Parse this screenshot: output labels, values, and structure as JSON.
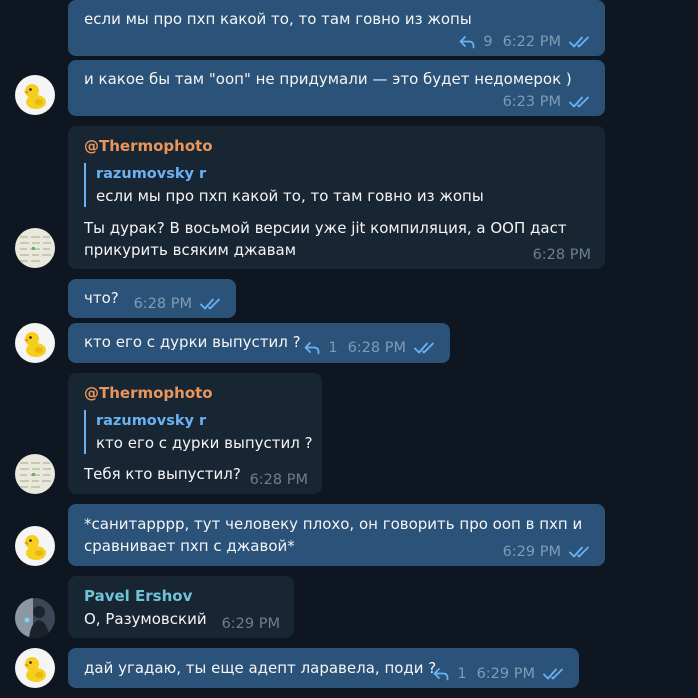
{
  "messages": [
    {
      "text": "если мы про пхп какой то, то там говно из жопы",
      "reply_count": "9",
      "time": "6:22 PM"
    },
    {
      "text": "и какое бы там \"ооп\" не придумали — это будет недомерок )",
      "time": "6:23 PM"
    },
    {
      "sender": "@Thermophoto",
      "quote_name": "razumovsky r",
      "quote_text": "если мы про пхп какой то, то там говно из жопы",
      "text_line1": "Ты дурак? В восьмой версии уже jit компиляция, а ООП даст",
      "text_line2": "прикурить всяким джавам",
      "time": "6:28 PM"
    },
    {
      "text": "что?",
      "time": "6:28 PM"
    },
    {
      "text": "кто его с дурки выпустил ?",
      "reply_count": "1",
      "time": "6:28 PM"
    },
    {
      "sender": "@Thermophoto",
      "quote_name": "razumovsky r",
      "quote_text": "кто его с дурки выпустил ?",
      "text": "Тебя кто выпустил?",
      "time": "6:28 PM"
    },
    {
      "text_line1": "*санитарррр, тут человеку плохо, он говорить про ооп в пхп и",
      "text_line2": "сравнивает пхп с джавой*",
      "time": "6:29 PM"
    },
    {
      "sender": "Pavel Ershov",
      "text": "О, Разумовский",
      "time": "6:29 PM"
    },
    {
      "text": "дай угадаю, ты еще адепт ларавела, поди ?",
      "reply_count": "1",
      "time": "6:29 PM"
    }
  ],
  "colors": {
    "outgoing": "#2b5278",
    "incoming": "#182533",
    "accent": "#6ab2f2",
    "orange": "#e8965a",
    "teal": "#6fc3d6"
  },
  "icons": {
    "reply": "reply-arrow-icon",
    "read": "double-check-icon",
    "avatar_duck": "duck-avatar-icon"
  }
}
